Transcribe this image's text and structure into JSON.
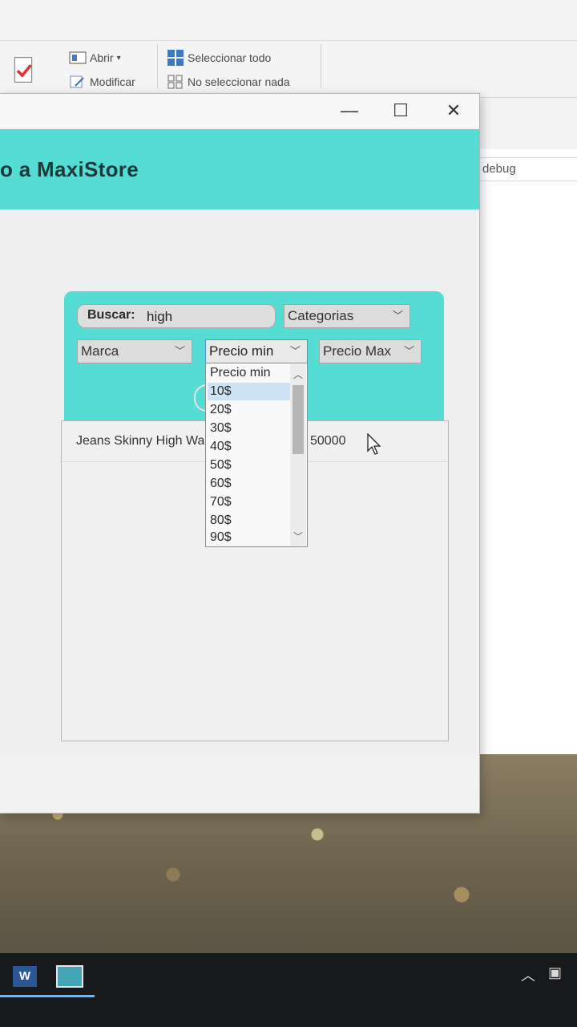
{
  "explorer": {
    "ribbon": {
      "open_label": "Abrir",
      "modify_label": "Modificar",
      "select_all_label": "Seleccionar todo",
      "select_none_label": "No seleccionar nada"
    },
    "debug_label": "debug"
  },
  "app": {
    "header_title": "o a MaxiStore",
    "search": {
      "label": "Buscar:",
      "value": "high"
    },
    "combos": {
      "categorias": "Categorias",
      "marca": "Marca",
      "precio_min": "Precio min",
      "precio_max": "Precio Max"
    },
    "dropdown_options": [
      "Precio min",
      "10$",
      "20$",
      "30$",
      "40$",
      "50$",
      "60$",
      "70$",
      "80$",
      "90$"
    ],
    "dropdown_selected_index": 1,
    "results": [
      {
        "name": "Jeans Skinny High Wa",
        "price": "50000"
      }
    ]
  },
  "colors": {
    "accent": "#55dcd5",
    "selection": "#cfe3f7"
  }
}
